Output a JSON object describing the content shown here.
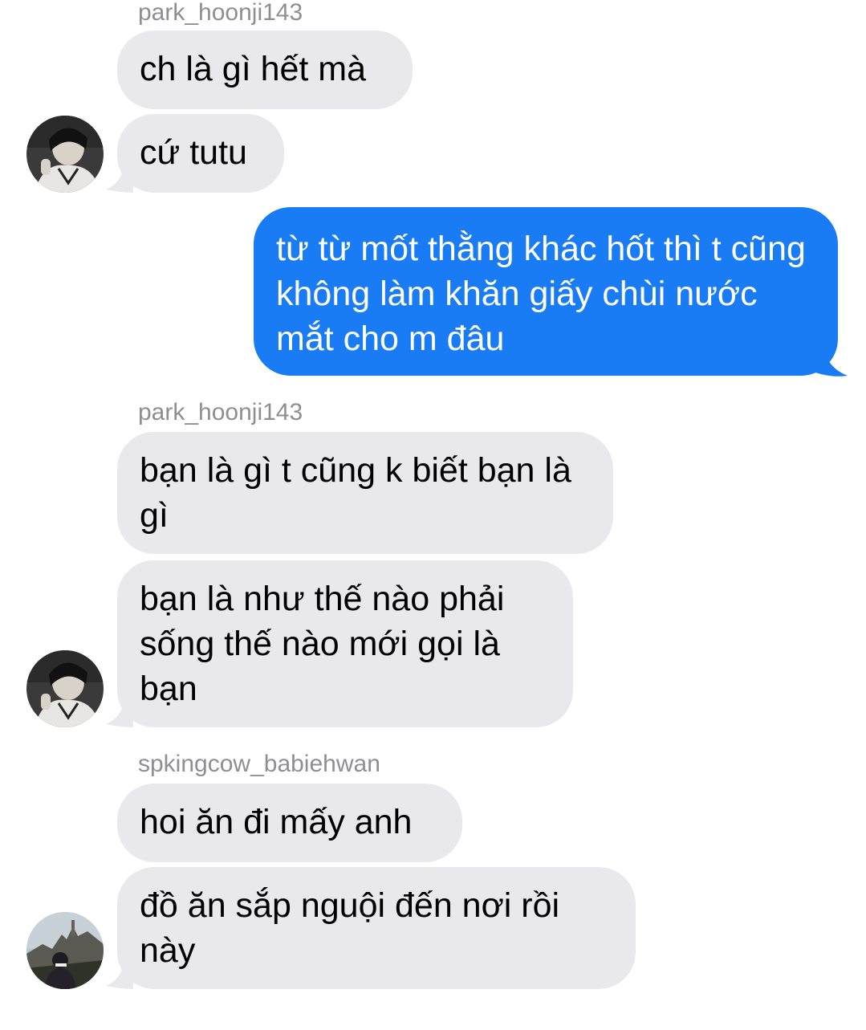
{
  "colors": {
    "incoming_bubble": "#e9e9eb",
    "outgoing_bubble": "#1a7cf5",
    "sender_name": "#8e8e93"
  },
  "messages": {
    "sender1": "park_hoonji143",
    "m1": "ch là gì hết mà",
    "m2": "cứ tutu",
    "m3": "từ từ mốt thằng khác hốt thì t cũng không làm khăn giấy chùi nước mắt cho m đâu",
    "sender2": "park_hoonji143",
    "m4": "bạn là gì t cũng k biết bạn là gì",
    "m5": "bạn là như thế nào phải sống thế nào mới gọi là bạn",
    "sender3": "spkingcow_babiehwan",
    "m6": "hoi ăn đi mấy anh",
    "m7": "đồ ăn sắp nguội đến nơi rồi này"
  },
  "avatars": {
    "a1": "user-avatar-park-hoonji",
    "a2": "user-avatar-park-hoonji",
    "a3": "user-avatar-spkingcow"
  }
}
